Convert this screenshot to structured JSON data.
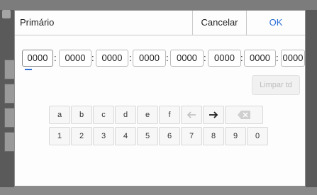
{
  "dialog": {
    "title": "Primário",
    "cancel_label": "Cancelar",
    "ok_label": "OK",
    "ok_color": "#2a6fd6"
  },
  "address_fields": [
    "0000",
    "0000",
    "0000",
    "0000",
    "0000",
    "0000",
    "0000",
    "0000"
  ],
  "separator": ":",
  "clear_all_label": "Limpar td",
  "keypad": {
    "letters": [
      "a",
      "b",
      "c",
      "d",
      "e",
      "f"
    ],
    "digits": [
      "1",
      "2",
      "3",
      "4",
      "5",
      "6",
      "7",
      "8",
      "9",
      "0"
    ],
    "icons": [
      "arrow-left-icon",
      "arrow-right-icon",
      "backspace-icon"
    ]
  }
}
